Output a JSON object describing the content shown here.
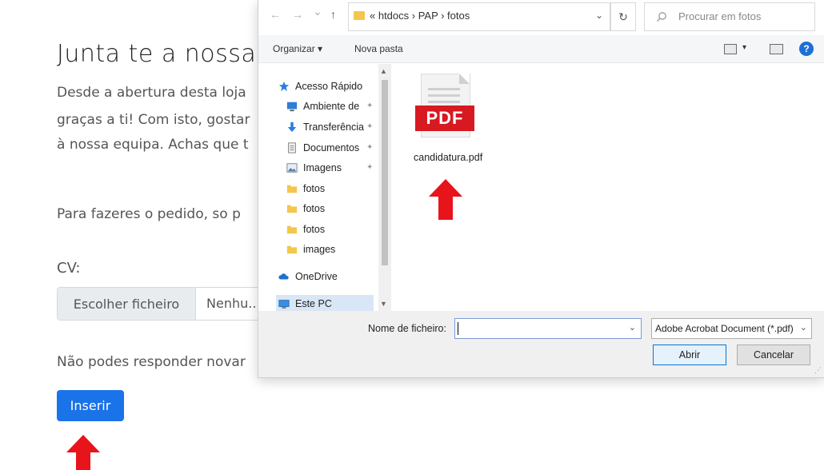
{
  "page": {
    "title": "Junta te a nossa",
    "paragraph_lines": [
      "Desde a abertura desta loja",
      "graças a ti! Com isto, gostar",
      "à nossa equipa. Achas que t"
    ],
    "request_text": "Para fazeres o pedido, so p",
    "cv_label": "CV:",
    "file_button": "Escolher ficheiro",
    "file_none": "Nenhu...",
    "notice": "Não podes responder novar",
    "submit": "Inserir"
  },
  "dialog": {
    "nav_back": "←",
    "nav_forward": "→",
    "nav_recent": "⌄",
    "nav_up": "↑",
    "address": "« htdocs › PAP › fotos",
    "address_chevron": "⌄",
    "refresh": "↻",
    "search_placeholder": "Procurar em fotos",
    "toolbar": {
      "organize": "Organizar ▾",
      "new_folder": "Nova pasta",
      "view_menu": "▾",
      "help": "?"
    },
    "sidebar": [
      {
        "label": "Acesso Rápido",
        "icon": "star-icon",
        "pinned": false
      },
      {
        "label": "Ambiente de",
        "icon": "desktop-icon",
        "pinned": true
      },
      {
        "label": "Transferência",
        "icon": "download-icon",
        "pinned": true
      },
      {
        "label": "Documentos",
        "icon": "documents-icon",
        "pinned": true
      },
      {
        "label": "Imagens",
        "icon": "images-icon",
        "pinned": true
      },
      {
        "label": "fotos",
        "icon": "folder-icon",
        "pinned": false
      },
      {
        "label": "fotos",
        "icon": "folder-icon",
        "pinned": false
      },
      {
        "label": "fotos",
        "icon": "folder-icon",
        "pinned": false
      },
      {
        "label": "images",
        "icon": "folder-icon",
        "pinned": false
      },
      {
        "label": "OneDrive",
        "icon": "cloud-icon",
        "pinned": false
      },
      {
        "label": "Este PC",
        "icon": "pc-icon",
        "pinned": false
      }
    ],
    "pin_glyph": "✦",
    "scroll_up": "▲",
    "scroll_down": "▼",
    "file": {
      "badge": "PDF",
      "name": "candidatura.pdf"
    },
    "filename_label": "Nome de ficheiro:",
    "filename_value": "",
    "filename_chevron": "⌄",
    "file_type": "Adobe Acrobat Document (*.pdf)",
    "file_type_chevron": "⌄",
    "open_button": "Abrir",
    "cancel_button": "Cancelar",
    "resize_grip": "⋰"
  },
  "colors": {
    "accent": "#1a73e8",
    "arrow": "#e8141b",
    "pdf_red": "#d71921"
  }
}
